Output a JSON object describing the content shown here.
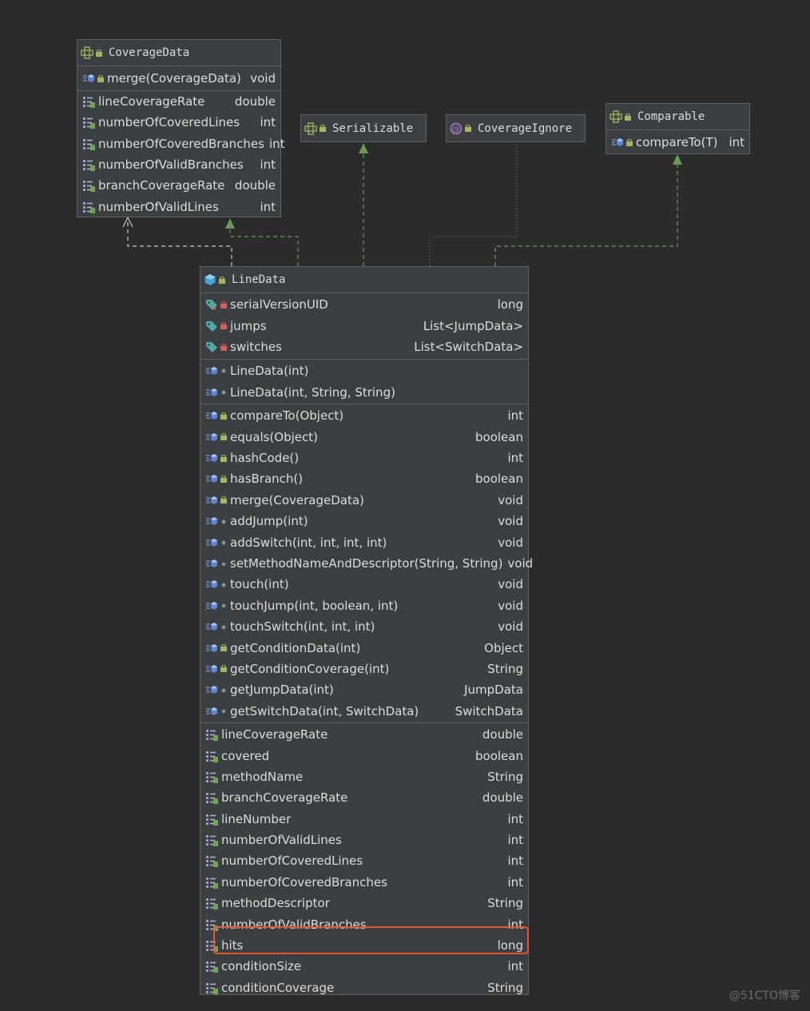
{
  "coverage_data": {
    "title": "CoverageData",
    "methods": [
      {
        "name": "merge(CoverageData)",
        "type": "void"
      }
    ],
    "properties": [
      {
        "name": "lineCoverageRate",
        "type": "double"
      },
      {
        "name": "numberOfCoveredLines",
        "type": "int"
      },
      {
        "name": "numberOfCoveredBranches",
        "type": "int"
      },
      {
        "name": "numberOfValidBranches",
        "type": "int"
      },
      {
        "name": "branchCoverageRate",
        "type": "double"
      },
      {
        "name": "numberOfValidLines",
        "type": "int"
      }
    ]
  },
  "serializable": {
    "title": "Serializable"
  },
  "coverage_ignore": {
    "title": "CoverageIgnore"
  },
  "comparable": {
    "title": "Comparable",
    "methods": [
      {
        "name": "compareTo(T)",
        "type": "int"
      }
    ]
  },
  "line_data": {
    "title": "LineData",
    "fields": [
      {
        "name": "serialVersionUID",
        "type": "long",
        "icon": "static-field-icon"
      },
      {
        "name": "jumps",
        "type": "List<JumpData>",
        "icon": "field-icon"
      },
      {
        "name": "switches",
        "type": "List<SwitchData>",
        "icon": "field-icon"
      }
    ],
    "constructors": [
      {
        "name": "LineData(int)",
        "type": ""
      },
      {
        "name": "LineData(int, String, String)",
        "type": ""
      }
    ],
    "methods": [
      {
        "name": "compareTo(Object)",
        "type": "int",
        "access": "public"
      },
      {
        "name": "equals(Object)",
        "type": "boolean",
        "access": "public"
      },
      {
        "name": "hashCode()",
        "type": "int",
        "access": "public"
      },
      {
        "name": "hasBranch()",
        "type": "boolean",
        "access": "public"
      },
      {
        "name": "merge(CoverageData)",
        "type": "void",
        "access": "public"
      },
      {
        "name": "addJump(int)",
        "type": "void",
        "access": "package"
      },
      {
        "name": "addSwitch(int, int, int, int)",
        "type": "void",
        "access": "package"
      },
      {
        "name": "setMethodNameAndDescriptor(String, String)",
        "type": "void",
        "access": "package"
      },
      {
        "name": "touch(int)",
        "type": "void",
        "access": "package"
      },
      {
        "name": "touchJump(int, boolean, int)",
        "type": "void",
        "access": "package"
      },
      {
        "name": "touchSwitch(int, int, int)",
        "type": "void",
        "access": "package"
      },
      {
        "name": "getConditionData(int)",
        "type": "Object",
        "access": "public"
      },
      {
        "name": "getConditionCoverage(int)",
        "type": "String",
        "access": "public"
      },
      {
        "name": "getJumpData(int)",
        "type": "JumpData",
        "access": "package"
      },
      {
        "name": "getSwitchData(int, SwitchData)",
        "type": "SwitchData",
        "access": "package"
      }
    ],
    "properties": [
      {
        "name": "lineCoverageRate",
        "type": "double"
      },
      {
        "name": "covered",
        "type": "boolean"
      },
      {
        "name": "methodName",
        "type": "String"
      },
      {
        "name": "branchCoverageRate",
        "type": "double"
      },
      {
        "name": "lineNumber",
        "type": "int"
      },
      {
        "name": "numberOfValidLines",
        "type": "int"
      },
      {
        "name": "numberOfCoveredLines",
        "type": "int"
      },
      {
        "name": "numberOfCoveredBranches",
        "type": "int"
      },
      {
        "name": "methodDescriptor",
        "type": "String"
      },
      {
        "name": "numberOfValidBranches",
        "type": "int"
      },
      {
        "name": "hits",
        "type": "long"
      },
      {
        "name": "conditionSize",
        "type": "int"
      },
      {
        "name": "conditionCoverage",
        "type": "String"
      }
    ]
  },
  "highlight_color": "#e4572e",
  "watermark": "@51CTO博客"
}
